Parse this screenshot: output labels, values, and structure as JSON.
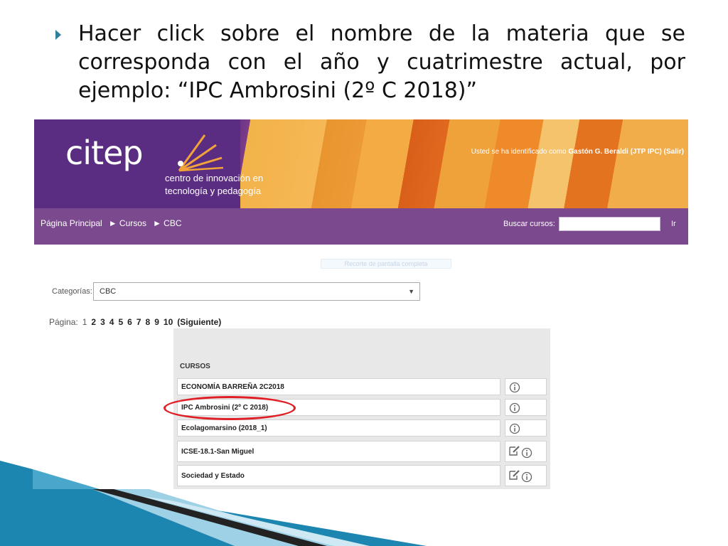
{
  "slide": {
    "bullet_text": "Hacer click sobre el nombre de la materia que se corresponda con el año y cuatrimestre actual, por ejemplo: “IPC Ambrosini (2º C 2018)”"
  },
  "site": {
    "logo_text": "citep",
    "logo_subtitle_line1": "centro de innovación en",
    "logo_subtitle_line2": "tecnología y pedagogía",
    "user_prefix": "Usted se ha identificado como",
    "user_name": "Gastón G. Beraldi (JTP IPC)",
    "logout": "(Salir)"
  },
  "nav": {
    "crumbs": [
      "Página Principal",
      "► Cursos",
      "► CBC"
    ],
    "search_label": "Buscar cursos:",
    "search_value": "",
    "search_button": "Ir"
  },
  "faded_caption": "Recorte de pantalla completa",
  "categories": {
    "label": "Categorías:",
    "selected": "CBC"
  },
  "pager": {
    "label": "Página:",
    "current": "1",
    "pages": [
      "2",
      "3",
      "4",
      "5",
      "6",
      "7",
      "8",
      "9",
      "10"
    ],
    "next": "(Siguiente)"
  },
  "courses": {
    "heading": "CURSOS",
    "items": [
      {
        "name": "ECONOMÍA BARREÑA 2C2018",
        "icons": [
          "info-icon"
        ]
      },
      {
        "name": "IPC Ambrosini (2º C 2018)",
        "icons": [
          "info-icon"
        ]
      },
      {
        "name": "Ecolagomarsino (2018_1)",
        "icons": [
          "info-icon"
        ]
      },
      {
        "name": "ICSE-18.1-San Miguel",
        "icons": [
          "enrol-icon",
          "info-icon"
        ]
      },
      {
        "name": "Sociedad y Estado",
        "icons": [
          "enrol-icon",
          "info-icon"
        ]
      }
    ]
  },
  "colors": {
    "banner_purple": "#5a2d82",
    "nav_purple": "#7b4a8e",
    "highlight_red": "#e01e26",
    "bullet_teal": "#2e7f9a"
  }
}
